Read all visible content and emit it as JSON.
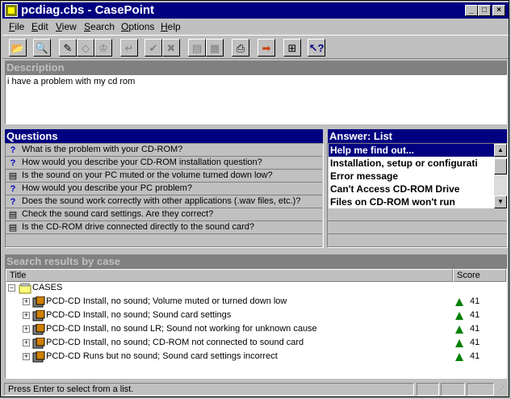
{
  "window": {
    "title": "pcdiag.cbs - CasePoint"
  },
  "menu": [
    {
      "label": "File",
      "u": "F",
      "rest": "ile"
    },
    {
      "label": "Edit",
      "u": "E",
      "rest": "dit"
    },
    {
      "label": "View",
      "u": "V",
      "rest": "iew"
    },
    {
      "label": "Search",
      "u": "S",
      "rest": "earch"
    },
    {
      "label": "Options",
      "u": "O",
      "rest": "ptions"
    },
    {
      "label": "Help",
      "u": "H",
      "rest": "elp"
    }
  ],
  "toolbar": {
    "icons": [
      "open-folder-icon",
      "find-icon",
      "edit-case-icon",
      "tag-icon",
      "trophy-icon",
      "back-icon",
      "check-icon",
      "cancel-icon",
      "report-icon",
      "notes-icon",
      "print-icon",
      "go-arrow-icon",
      "tree-icon",
      "help-pointer-icon"
    ]
  },
  "description": {
    "header": "Description",
    "text": "i have a problem with my cd rom"
  },
  "questions": {
    "header": "Questions",
    "items": [
      {
        "icon": "question-icon",
        "text": "What is the problem with your CD-ROM?"
      },
      {
        "icon": "question-icon",
        "text": "How would you describe your CD-ROM installation question?"
      },
      {
        "icon": "note-icon",
        "text": "Is the sound on your PC muted or the volume turned down low?"
      },
      {
        "icon": "question-icon",
        "text": "How would you describe your PC problem?"
      },
      {
        "icon": "question-icon",
        "text": "Does the sound work correctly with other applications (.wav files, etc.)?"
      },
      {
        "icon": "note-icon",
        "text": "Check the sound card settings. Are they correct?"
      },
      {
        "icon": "note-icon",
        "text": "Is the CD-ROM drive connected directly to the sound card?"
      }
    ]
  },
  "answer": {
    "header": "Answer: List",
    "items": [
      "Help me find out...",
      "Installation, setup or configurati",
      "Error message",
      "Can't Access CD-ROM Drive",
      "Files on CD-ROM won't run"
    ],
    "selected_index": 0
  },
  "results": {
    "header": "Search results by case",
    "columns": {
      "title": "Title",
      "score": "Score"
    },
    "root": "CASES",
    "cases": [
      {
        "title": "PCD-CD Install, no sound; Volume muted or turned down low",
        "score": "41"
      },
      {
        "title": "PCD-CD Install, no sound; Sound card settings",
        "score": "41"
      },
      {
        "title": "PCD-CD Install, no sound LR; Sound not working for unknown cause",
        "score": "41"
      },
      {
        "title": "PCD-CD Install, no sound; CD-ROM not connected to sound card",
        "score": "41"
      },
      {
        "title": "PCD-CD Runs but no sound; Sound card settings incorrect",
        "score": "41"
      }
    ]
  },
  "status": {
    "text": "Press Enter to select from a list."
  },
  "colors": {
    "active_header": "#000080",
    "inactive_header": "#808080",
    "score_up": "#008000"
  }
}
